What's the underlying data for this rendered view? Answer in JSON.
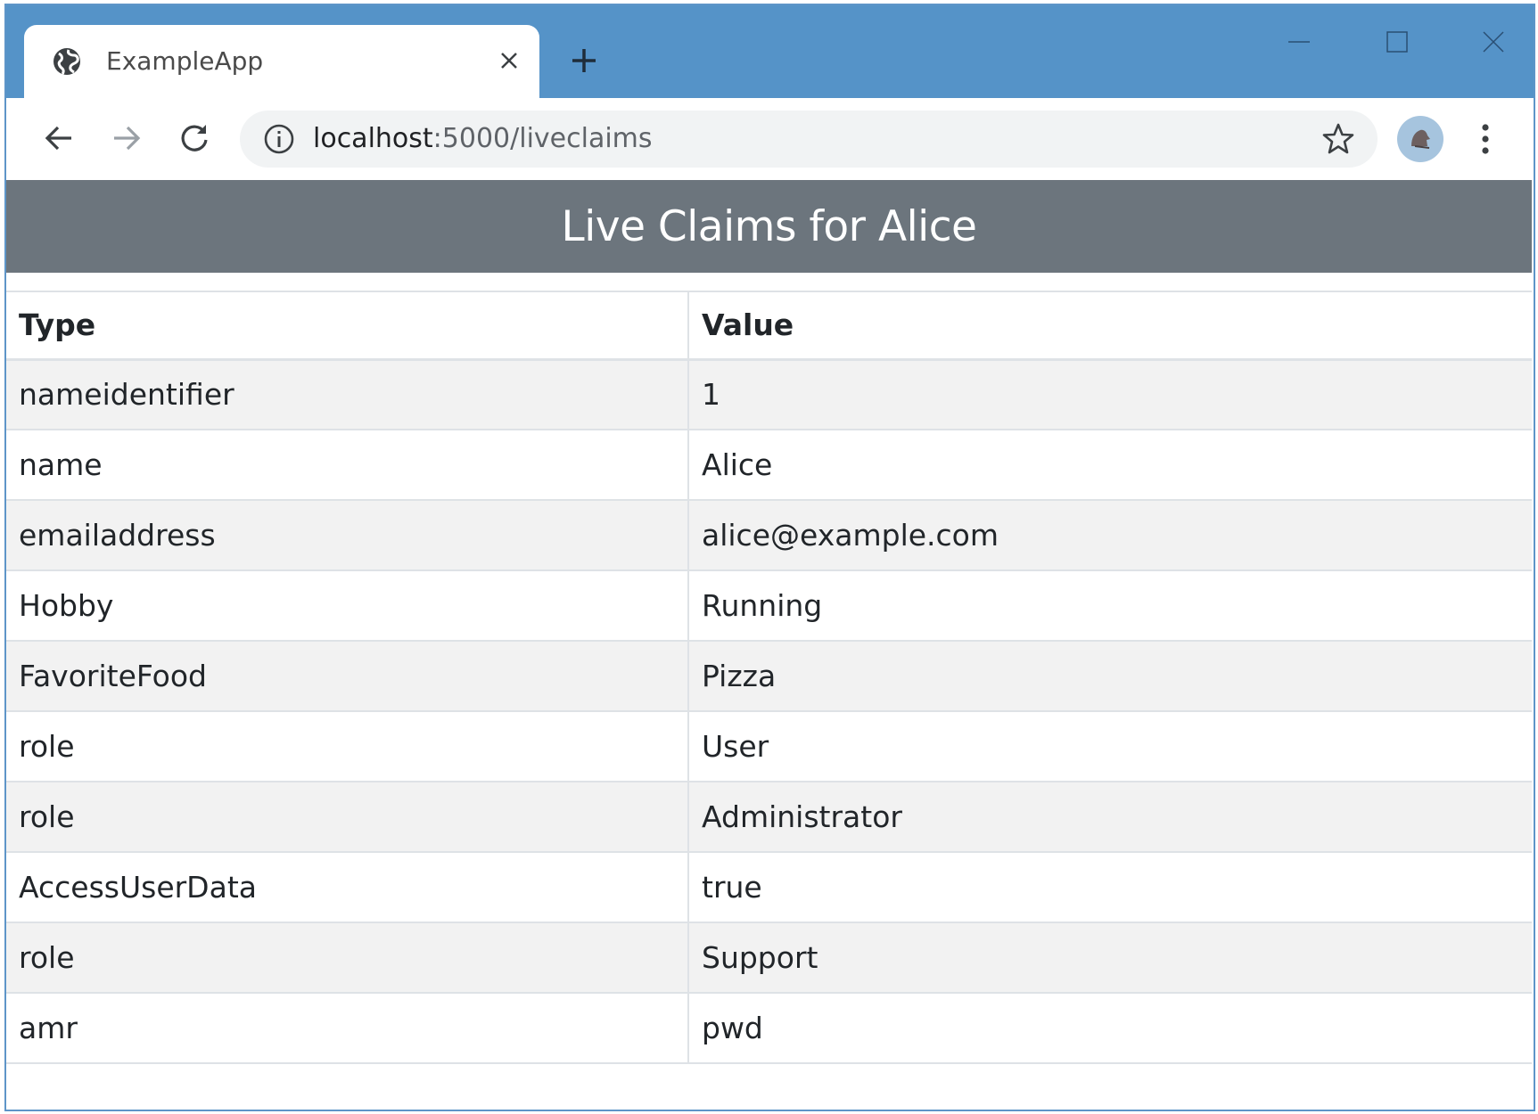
{
  "browser": {
    "tab_title": "ExampleApp",
    "url_host": "localhost",
    "url_path": ":5000/liveclaims"
  },
  "page": {
    "title": "Live Claims for Alice",
    "headers": {
      "type": "Type",
      "value": "Value"
    },
    "rows": [
      {
        "type": "nameidentifier",
        "value": "1"
      },
      {
        "type": "name",
        "value": "Alice"
      },
      {
        "type": "emailaddress",
        "value": "alice@example.com"
      },
      {
        "type": "Hobby",
        "value": "Running"
      },
      {
        "type": "FavoriteFood",
        "value": "Pizza"
      },
      {
        "type": "role",
        "value": "User"
      },
      {
        "type": "role",
        "value": "Administrator"
      },
      {
        "type": "AccessUserData",
        "value": "true"
      },
      {
        "type": "role",
        "value": "Support"
      },
      {
        "type": "amr",
        "value": "pwd"
      }
    ]
  },
  "icons": {
    "favicon": "globe-icon",
    "tab_close": "close-icon",
    "new_tab": "plus-icon",
    "back": "back-arrow-icon",
    "forward": "forward-arrow-icon",
    "reload": "reload-icon",
    "site_info": "info-icon",
    "bookmark": "star-icon",
    "profile": "avatar-icon",
    "menu": "kebab-menu-icon",
    "minimize": "minimize-icon",
    "maximize": "maximize-icon",
    "close_window": "window-close-icon"
  },
  "colors": {
    "titlebar": "#5593c8",
    "header_bg": "#6c757d",
    "stripe": "#f2f2f2",
    "border": "#dee2e6"
  }
}
